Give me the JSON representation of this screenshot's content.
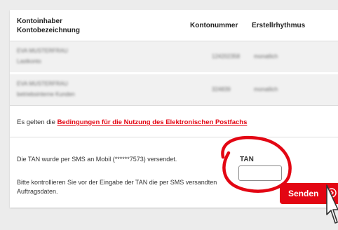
{
  "table": {
    "col_owner_line1": "Kontoinhaber",
    "col_owner_line2": "Kontobezeichnung",
    "col_number": "Kontonummer",
    "col_rhythm": "Erstellrhythmus"
  },
  "accounts": [
    {
      "owner": "EVA MUSTERFRAU",
      "description": "Lastkonto",
      "number": "124202358",
      "rhythm": "monatlich"
    },
    {
      "owner": "EVA MUSTERFRAU",
      "description": "betriebsinterne Kunden",
      "number": "324839",
      "rhythm": "monatlich"
    }
  ],
  "terms": {
    "prefix": "Es gelten die ",
    "link": "Bedingungen für die Nutzung des Elektronischen Postfachs"
  },
  "tan": {
    "info": "Die TAN wurde per SMS an Mobil (******7573) versendet.",
    "verify": "Bitte kontrollieren Sie vor der Eingabe der TAN die per SMS versandten Auftragsdaten.",
    "label": "TAN",
    "value": ""
  },
  "actions": {
    "send_label": "Senden"
  },
  "colors": {
    "accent": "#e30613",
    "row_background": "#f1f1f1"
  },
  "icons": {
    "send": "chevron-right-circle-icon",
    "cursor": "mouse-pointer-icon"
  }
}
